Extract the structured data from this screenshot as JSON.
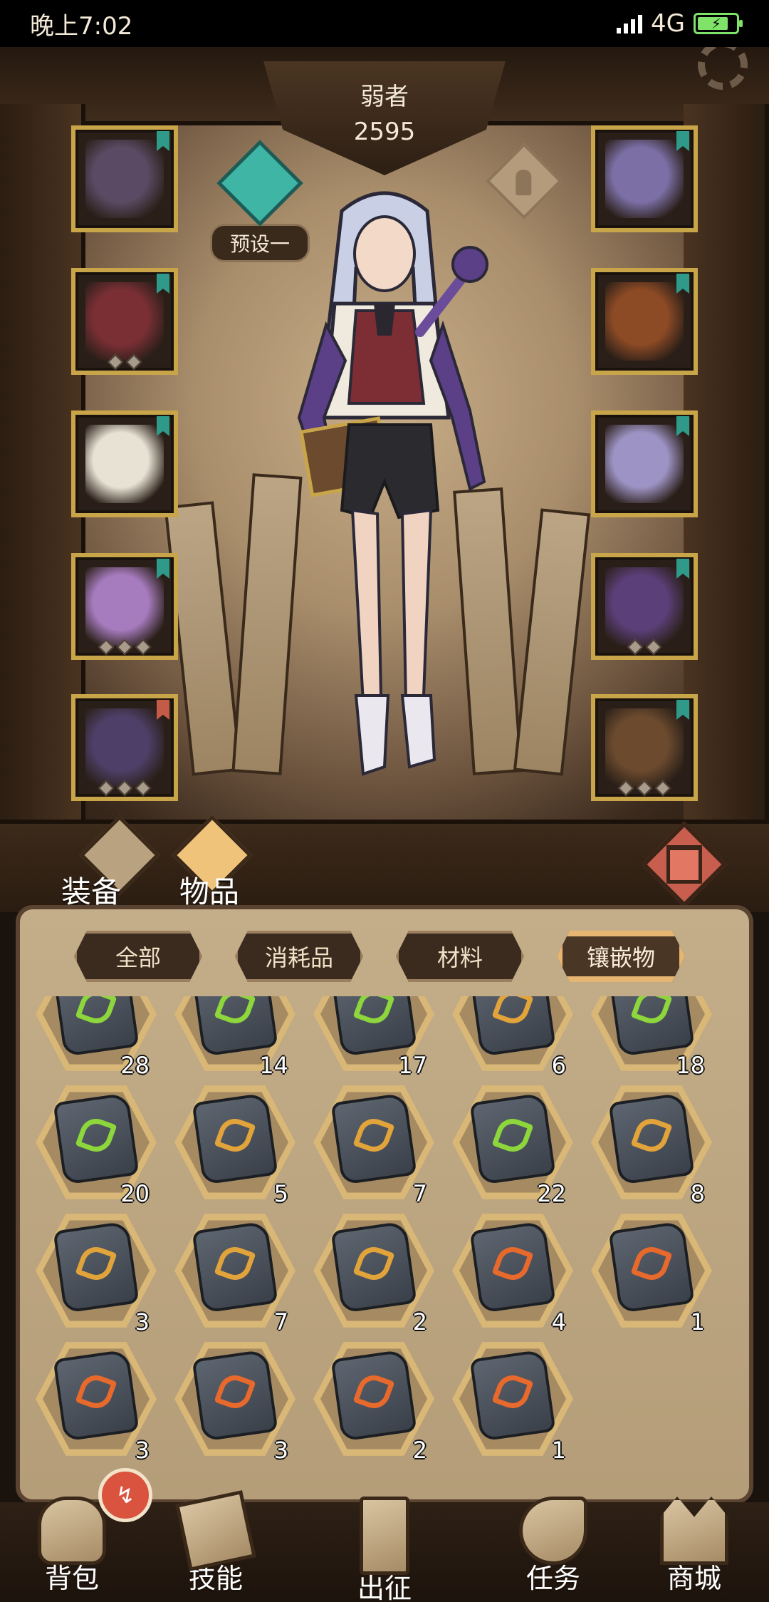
{
  "status": {
    "time": "晚上7:02",
    "network": "4G",
    "signal_icon": "signal-icon",
    "battery_icon": "battery-charging-icon",
    "battery_level": 0.8,
    "accent": "#7fe36a"
  },
  "header": {
    "name": "弱者",
    "score": "2595",
    "preset_label": "预设一"
  },
  "equipment_slots": {
    "left": [
      {
        "icon": "crossbow-weapon-icon",
        "color": "#5a4a63"
      },
      {
        "icon": "vest-armor-icon",
        "color": "#7a2f35"
      },
      {
        "icon": "gloves-icon",
        "color": "#e8e2d4"
      },
      {
        "icon": "pants-icon",
        "color": "#a77cbf"
      },
      {
        "icon": "boots-icon",
        "color": "#4e3f68"
      }
    ],
    "right": [
      {
        "icon": "amulet-icon",
        "color": "#7b6fa6"
      },
      {
        "icon": "bracelet-icon",
        "color": "#8c4a25"
      },
      {
        "icon": "ring-icon",
        "color": "#9d93c4"
      },
      {
        "icon": "staff-icon",
        "color": "#5b3f78"
      },
      {
        "icon": "spellbook-icon",
        "color": "#6b4a2e"
      }
    ]
  },
  "main_tabs": [
    {
      "label": "装备",
      "active": false
    },
    {
      "label": "物品",
      "active": true
    }
  ],
  "filters": [
    {
      "label": "全部",
      "active": false
    },
    {
      "label": "消耗品",
      "active": false
    },
    {
      "label": "材料",
      "active": false
    },
    {
      "label": "镶嵌物",
      "active": true
    }
  ],
  "gems": [
    {
      "count": "28",
      "rune_color": "#8dd63b"
    },
    {
      "count": "14",
      "rune_color": "#8dd63b"
    },
    {
      "count": "17",
      "rune_color": "#8dd63b"
    },
    {
      "count": "6",
      "rune_color": "#e2a43a"
    },
    {
      "count": "18",
      "rune_color": "#8dd63b"
    },
    {
      "count": "20",
      "rune_color": "#8dd63b"
    },
    {
      "count": "5",
      "rune_color": "#e2a43a"
    },
    {
      "count": "7",
      "rune_color": "#e2a43a"
    },
    {
      "count": "22",
      "rune_color": "#8dd63b"
    },
    {
      "count": "8",
      "rune_color": "#e2a43a"
    },
    {
      "count": "3",
      "rune_color": "#e2a43a"
    },
    {
      "count": "7",
      "rune_color": "#e2a43a"
    },
    {
      "count": "2",
      "rune_color": "#e2a43a"
    },
    {
      "count": "4",
      "rune_color": "#e8692c"
    },
    {
      "count": "1",
      "rune_color": "#e8692c"
    },
    {
      "count": "3",
      "rune_color": "#e8692c"
    },
    {
      "count": "3",
      "rune_color": "#e8692c"
    },
    {
      "count": "2",
      "rune_color": "#e8692c"
    },
    {
      "count": "1",
      "rune_color": "#e8692c"
    }
  ],
  "bottom_nav": [
    {
      "label": "背包",
      "icon": "backpack-icon"
    },
    {
      "label": "技能",
      "icon": "skill-card-icon"
    },
    {
      "label": "出征",
      "icon": "sword-map-icon"
    },
    {
      "label": "任务",
      "icon": "quest-horn-icon"
    },
    {
      "label": "商城",
      "icon": "shop-crown-icon"
    }
  ],
  "badge": {
    "icon": "notification-badge-icon"
  }
}
